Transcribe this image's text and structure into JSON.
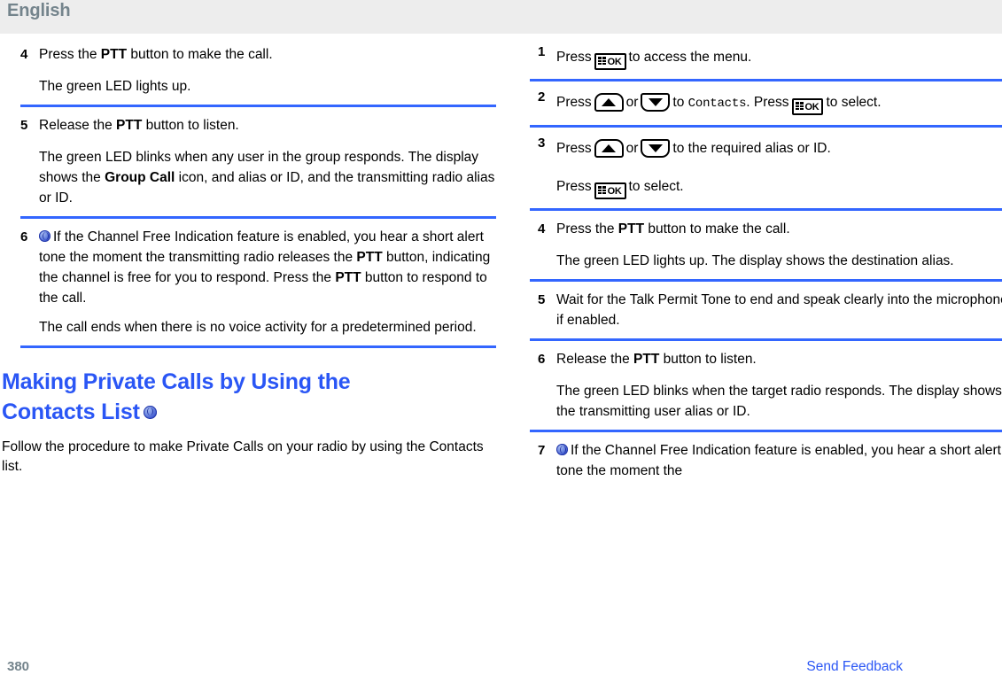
{
  "header": {
    "language_label": "English"
  },
  "icons": {
    "globe": "globe-icon",
    "ok_key": "ok-key-icon",
    "ok_key_label": "OK",
    "up_key": "up-arrow-key-icon",
    "down_key": "down-arrow-key-icon"
  },
  "left_column": {
    "steps": [
      {
        "number": "4",
        "lines": [
          {
            "pre": "Press the ",
            "bold": "PTT",
            "post": " button to make the call."
          },
          {
            "pre": "The green LED lights up.",
            "bold": "",
            "post": ""
          }
        ]
      },
      {
        "number": "5",
        "lines": [
          {
            "pre": "Release the ",
            "bold": "PTT",
            "post": " button to listen."
          },
          {
            "pre": "The green LED blinks when any user in the group responds. The display shows the ",
            "bold": "Group Call",
            "post": " icon, and alias or ID, and the transmitting radio alias or ID."
          }
        ]
      },
      {
        "number": "6",
        "lines": [
          {
            "pre": "If the Channel Free Indication feature is enabled, you hear a short alert tone the moment the transmitting radio releases the ",
            "bold": "PTT",
            "post": " button, indicating the channel is free for you to respond. Press the ",
            "bold2": "PTT",
            "post2": " button to respond to the call."
          },
          {
            "pre": "The call ends when there is no voice activity for a predetermined period.",
            "bold": "",
            "post": ""
          }
        ]
      }
    ],
    "section": {
      "heading_line1": "Making Private Calls by Using the",
      "heading_line2": "Contacts List",
      "body": "Follow the procedure to make Private Calls on your radio by using the Contacts list."
    }
  },
  "right_column": {
    "steps": [
      {
        "number": "1",
        "text_before_key": "Press",
        "text_after_key": "to access the menu."
      },
      {
        "number": "2",
        "press_label": "Press",
        "or_label": "or",
        "to_label": "to",
        "target": "Contacts",
        "period": ".",
        "press2_label": "Press",
        "to_label2": "to",
        "select_label": "select."
      },
      {
        "number": "3",
        "press_label": "Press",
        "or_label": "or",
        "after": "to the required alias or ID.",
        "press2_label": "Press",
        "select_label": "to select."
      },
      {
        "number": "4",
        "line1_pre": "Press the ",
        "line1_bold": "PTT",
        "line1_post": " button to make the call.",
        "line2": "The green LED lights up. The display shows the destination alias."
      },
      {
        "number": "5",
        "line1": "Wait for the Talk Permit Tone to end and speak clearly into the microphone if enabled."
      },
      {
        "number": "6",
        "line1_pre": "Release the ",
        "line1_bold": "PTT",
        "line1_post": " button to listen.",
        "line2": "The green LED blinks when the target radio responds. The display shows the transmitting user alias or ID."
      },
      {
        "number": "7",
        "line1": "If the Channel Free Indication feature is enabled, you hear a short alert tone the moment the"
      }
    ]
  },
  "footer": {
    "page_number": "380",
    "feedback_link": "Send Feedback"
  },
  "colors": {
    "rule_blue": "#3366ff",
    "link_blue": "#2a56f5",
    "header_gray": "#74848c",
    "header_band": "#ededed"
  }
}
